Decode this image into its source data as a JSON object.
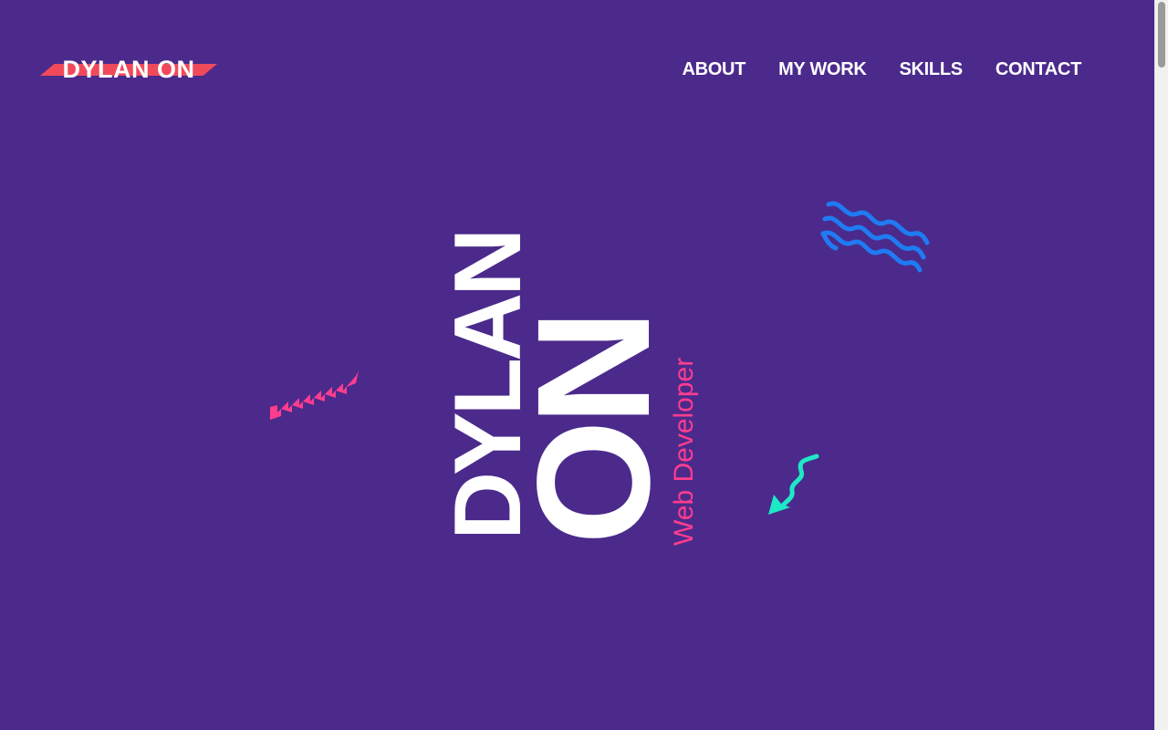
{
  "header": {
    "logo_text": "DYLAN ON"
  },
  "nav": {
    "items": [
      "ABOUT",
      "MY WORK",
      "SKILLS",
      "CONTACT"
    ]
  },
  "hero": {
    "first_name": "DYLAN",
    "last_name": "ON",
    "role": "Web Developer"
  },
  "decorations": [
    {
      "name": "pink-zigzag",
      "color": "#ff3d8d"
    },
    {
      "name": "blue-waves",
      "color": "#1f7bf2"
    },
    {
      "name": "teal-squiggle-arrow",
      "color": "#1de9c6"
    }
  ],
  "colors": {
    "background": "#4b2a8c",
    "logo_stripe": "#f04a5a",
    "text": "#ffffff",
    "accent": "#ff3d8d"
  }
}
